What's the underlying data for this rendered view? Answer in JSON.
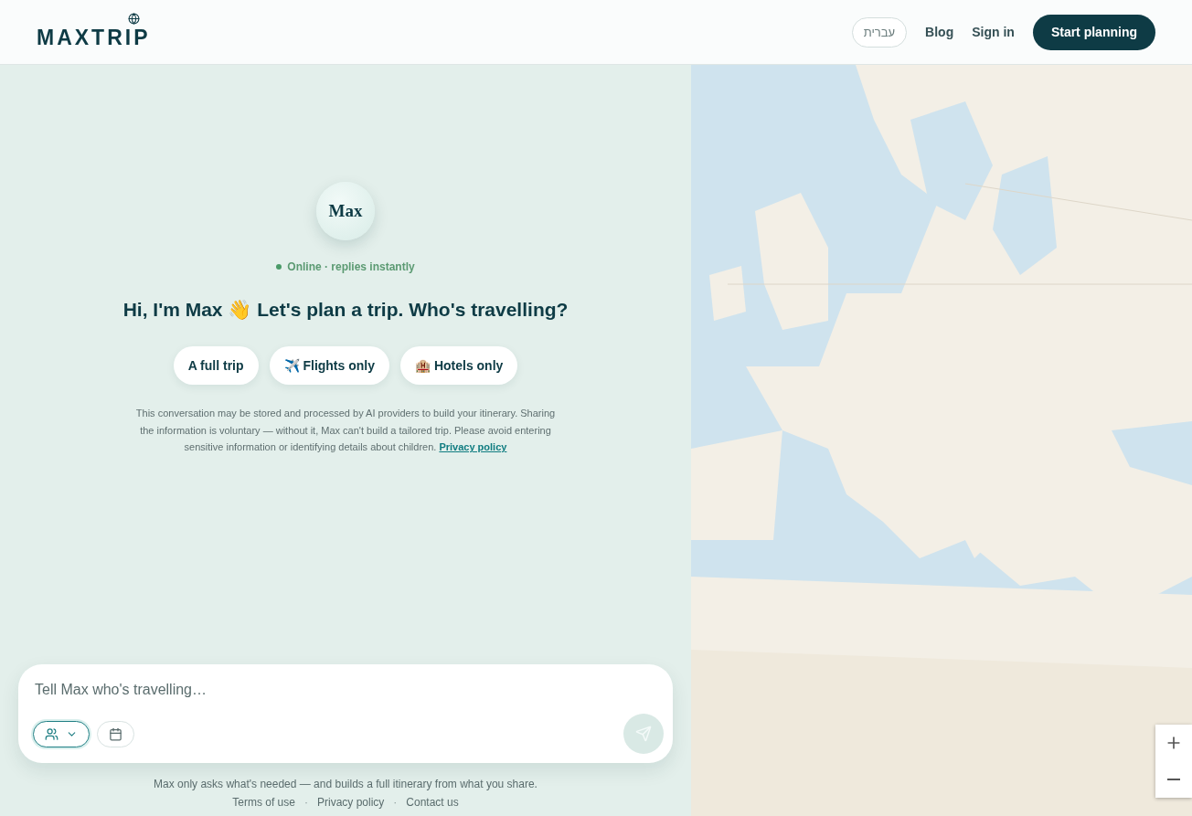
{
  "header": {
    "logo": "MAXTRIP",
    "language": "עברית",
    "links": [
      "Blog",
      "Sign in"
    ],
    "cta": "Start planning"
  },
  "assistant": {
    "avatar": "Max",
    "online": true,
    "status": "Online · replies instantly",
    "greeting": "Hi, I'm Max 👋 Let's plan a trip. Who's travelling?"
  },
  "options": [
    "A full trip",
    "✈️ Flights only",
    "🏨 Hotels only"
  ],
  "disclaimer": {
    "text": "This conversation may be stored and processed by AI providers to build your itinerary. Sharing the information is voluntary — without it, Max can't build a tailored trip. Please avoid entering sensitive information or identifying details about children.",
    "link": "Privacy policy"
  },
  "composer": {
    "placeholder": "Tell Max who's travelling…",
    "tools": [
      {
        "kind": "travellers",
        "active": true
      },
      {
        "kind": "dates",
        "active": false
      }
    ],
    "send_disabled": true
  },
  "footer": {
    "note": "Max only asks what's needed — and builds a full itinerary from what you share.",
    "items": [
      {
        "kind": "link",
        "text": "Terms of use"
      },
      {
        "kind": "separator",
        "text": "·"
      },
      {
        "kind": "link",
        "text": "Privacy policy"
      },
      {
        "kind": "separator",
        "text": "·"
      },
      {
        "kind": "link",
        "text": "Contact us"
      }
    ]
  }
}
